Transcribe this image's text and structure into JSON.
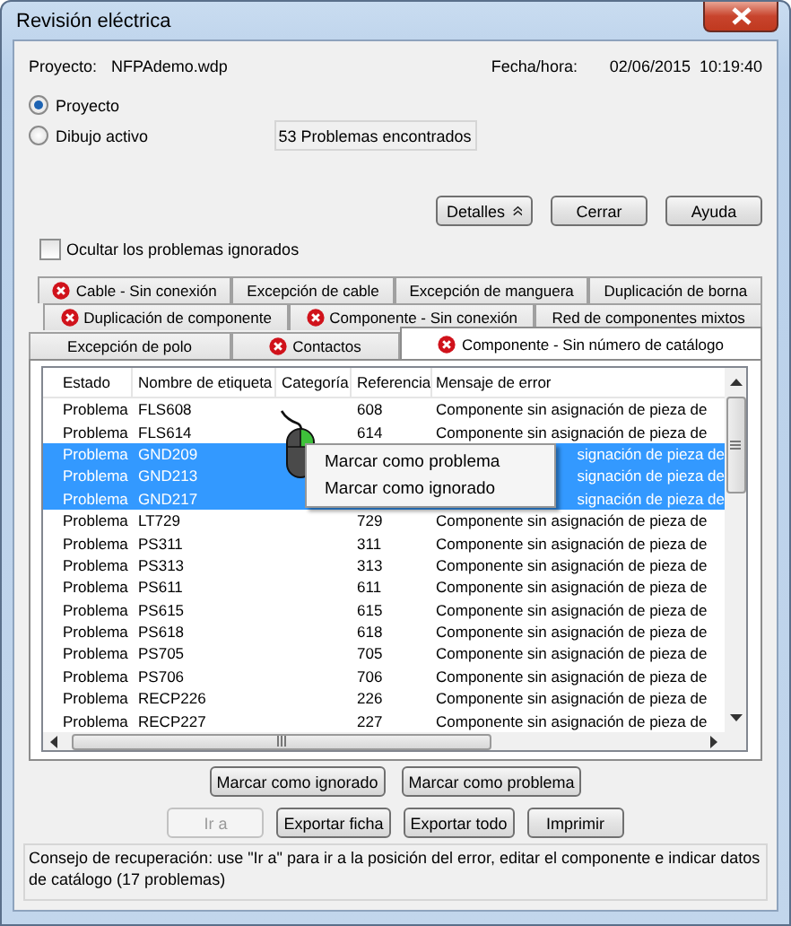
{
  "window": {
    "title": "Revisión eléctrica"
  },
  "project": {
    "label": "Proyecto:",
    "value": "NFPAdemo.wdp"
  },
  "datetime": {
    "label": "Fecha/hora:",
    "value": "02/06/2015  10:19:40"
  },
  "scope": [
    {
      "label": "Proyecto",
      "selected": true
    },
    {
      "label": "Dibujo activo",
      "selected": false
    }
  ],
  "count": "53 Problemas encontrados",
  "top_buttons": [
    {
      "label": "Detalles",
      "kind": "collapse"
    },
    {
      "label": "Cerrar",
      "kind": "plain"
    },
    {
      "label": "Ayuda",
      "kind": "plain"
    }
  ],
  "hide_ignored": {
    "label": "Ocultar los problemas ignorados",
    "checked": false
  },
  "tab_rows": [
    [
      {
        "label": "Cable - Sin conexión",
        "error": true,
        "selected": false
      },
      {
        "label": "Excepción de cable",
        "error": false,
        "selected": false
      },
      {
        "label": "Excepción de manguera",
        "error": false,
        "selected": false
      },
      {
        "label": "Duplicación de borna",
        "error": false,
        "selected": false
      }
    ],
    [
      {
        "label": "Duplicación de componente",
        "error": true,
        "selected": false
      },
      {
        "label": "Componente - Sin conexión",
        "error": true,
        "selected": false
      },
      {
        "label": "Red de componentes mixtos",
        "error": false,
        "selected": false
      }
    ],
    [
      {
        "label": "Excepción de polo",
        "error": false,
        "selected": false
      },
      {
        "label": "Contactos",
        "error": true,
        "selected": false
      },
      {
        "label": "Componente - Sin número de catálogo",
        "error": true,
        "selected": true
      }
    ]
  ],
  "table": {
    "columns": [
      "Estado",
      "Nombre de etiqueta",
      "Categoría",
      "Referencia",
      "Mensaje de error"
    ],
    "rows": [
      {
        "status": "Problema",
        "name": "FLS608",
        "reference": "608",
        "message": "Componente sin asignación de pieza de",
        "selected": false
      },
      {
        "status": "Problema",
        "name": "FLS614",
        "reference": "614",
        "message": "Componente sin asignación de pieza de",
        "selected": false
      },
      {
        "status": "Problema",
        "name": "GND209",
        "message": "signación de pieza de",
        "selected": true
      },
      {
        "status": "Problema",
        "name": "GND213",
        "message": "signación de pieza de",
        "selected": true
      },
      {
        "status": "Problema",
        "name": "GND217",
        "message": "signación de pieza de",
        "selected": true
      },
      {
        "status": "Problema",
        "name": "LT729",
        "reference": "729",
        "message": "Componente sin asignación de pieza de",
        "selected": false
      },
      {
        "status": "Problema",
        "name": "PS311",
        "reference": "311",
        "message": "Componente sin asignación de pieza de",
        "selected": false
      },
      {
        "status": "Problema",
        "name": "PS313",
        "reference": "313",
        "message": "Componente sin asignación de pieza de",
        "selected": false
      },
      {
        "status": "Problema",
        "name": "PS611",
        "reference": "611",
        "message": "Componente sin asignación de pieza de",
        "selected": false
      },
      {
        "status": "Problema",
        "name": "PS615",
        "reference": "615",
        "message": "Componente sin asignación de pieza de",
        "selected": false
      },
      {
        "status": "Problema",
        "name": "PS618",
        "reference": "618",
        "message": "Componente sin asignación de pieza de",
        "selected": false
      },
      {
        "status": "Problema",
        "name": "PS705",
        "reference": "705",
        "message": "Componente sin asignación de pieza de",
        "selected": false
      },
      {
        "status": "Problema",
        "name": "PS706",
        "reference": "706",
        "message": "Componente sin asignación de pieza de",
        "selected": false
      },
      {
        "status": "Problema",
        "name": "RECP226",
        "reference": "226",
        "message": "Componente sin asignación de pieza de",
        "selected": false
      },
      {
        "status": "Problema",
        "name": "RECP227",
        "reference": "227",
        "message": "Componente sin asignación de pieza de",
        "selected": false
      }
    ]
  },
  "context_menu": [
    "Marcar como problema",
    "Marcar como ignorado"
  ],
  "mark_buttons": [
    "Marcar como ignorado",
    "Marcar como problema"
  ],
  "action_buttons": [
    {
      "label": "Ir a",
      "disabled": true
    },
    {
      "label": "Exportar ficha",
      "disabled": false
    },
    {
      "label": "Exportar todo",
      "disabled": false
    },
    {
      "label": "Imprimir",
      "disabled": false
    }
  ],
  "advice": "Consejo de recuperación: use \"Ir a\" para ir a la posición del error, editar el componente e indicar datos de catálogo (17 problemas)"
}
